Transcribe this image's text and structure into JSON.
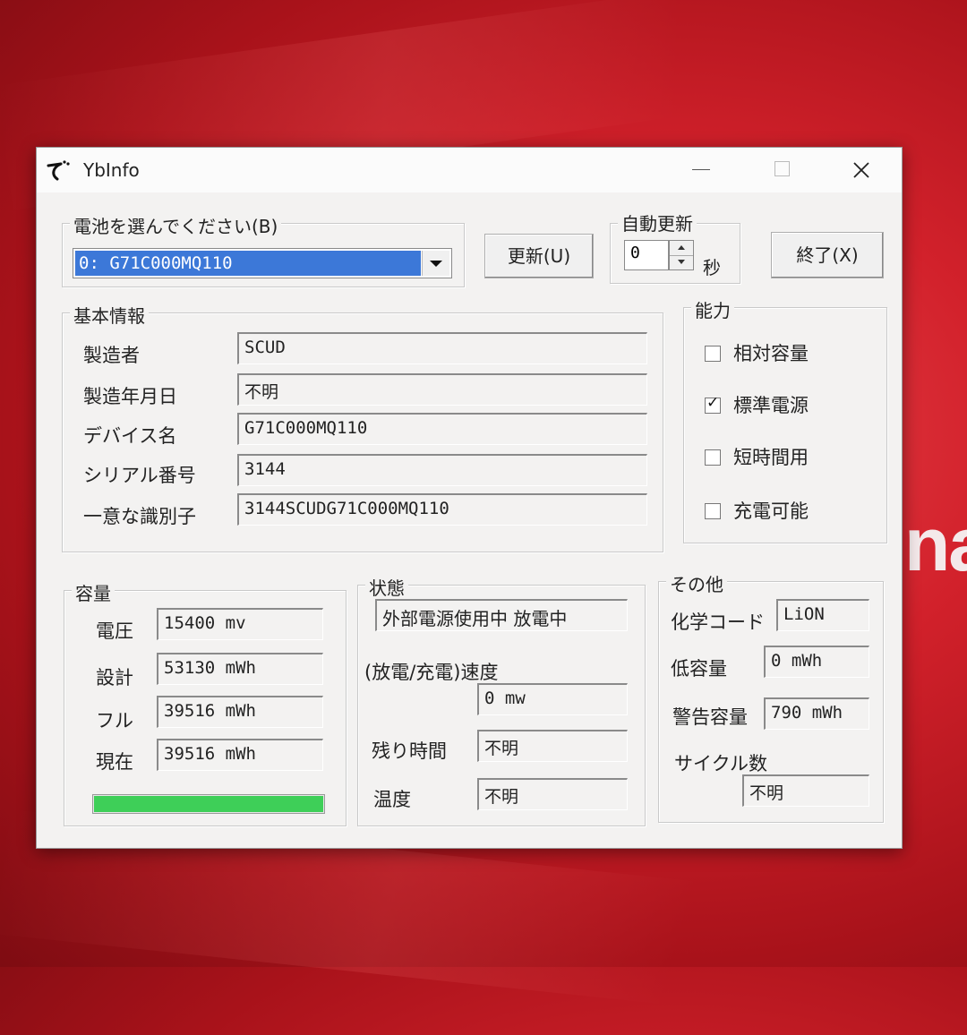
{
  "window": {
    "title": "YbInfo"
  },
  "battery_select": {
    "label": "電池を選んでください(B)",
    "selected": "0: G71C000MQ110"
  },
  "buttons": {
    "refresh": "更新(U)",
    "exit": "終了(X)"
  },
  "auto_update": {
    "label": "自動更新",
    "value": "0",
    "unit": "秒"
  },
  "basic_info": {
    "title": "基本情報",
    "rows": [
      {
        "label": "製造者",
        "value": "SCUD"
      },
      {
        "label": "製造年月日",
        "value": "不明"
      },
      {
        "label": "デバイス名",
        "value": "G71C000MQ110"
      },
      {
        "label": "シリアル番号",
        "value": "3144"
      },
      {
        "label": "一意な識別子",
        "value": "3144SCUDG71C000MQ110"
      }
    ]
  },
  "capability": {
    "title": "能力",
    "items": [
      {
        "label": "相対容量",
        "checked": false
      },
      {
        "label": "標準電源",
        "checked": true
      },
      {
        "label": "短時間用",
        "checked": false
      },
      {
        "label": "充電可能",
        "checked": false
      }
    ]
  },
  "capacity": {
    "title": "容量",
    "rows": [
      {
        "label": "電圧",
        "value": "15400 mv"
      },
      {
        "label": "設計",
        "value": "53130 mWh"
      },
      {
        "label": "フル",
        "value": "39516 mWh"
      },
      {
        "label": "現在",
        "value": "39516 mWh"
      }
    ],
    "level_fraction": 1.0,
    "bar_color": "#3ecf58"
  },
  "status": {
    "title": "状態",
    "state": "外部電源使用中 放電中",
    "rate_label": "(放電/充電)速度",
    "rate_value": "0 mw",
    "remaining_label": "残り時間",
    "remaining_value": "不明",
    "temp_label": "温度",
    "temp_value": "不明"
  },
  "other": {
    "title": "その他",
    "chem_label": "化学コード",
    "chem_value": "LiON",
    "low_label": "低容量",
    "low_value": "0 mWh",
    "warn_label": "警告容量",
    "warn_value": "790 mWh",
    "cycle_label": "サイクル数",
    "cycle_value": "不明"
  },
  "background": {
    "partial_text": "na"
  }
}
